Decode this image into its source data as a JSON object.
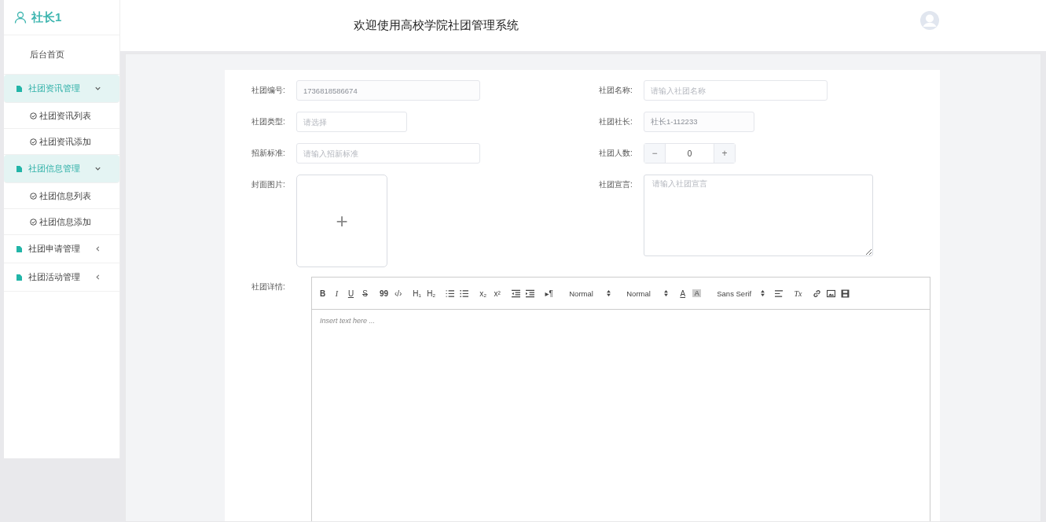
{
  "sidebar": {
    "user": "社长1",
    "items": [
      {
        "label": "后台首页",
        "kind": "link"
      },
      {
        "label": "社团资讯管理",
        "kind": "group",
        "expanded": true,
        "children": [
          {
            "label": "社团资讯列表"
          },
          {
            "label": "社团资讯添加"
          }
        ]
      },
      {
        "label": "社团信息管理",
        "kind": "group",
        "expanded": true,
        "children": [
          {
            "label": "社团信息列表"
          },
          {
            "label": "社团信息添加"
          }
        ]
      },
      {
        "label": "社团申请管理",
        "kind": "group",
        "expanded": false
      },
      {
        "label": "社团活动管理",
        "kind": "group",
        "expanded": false
      }
    ]
  },
  "header": {
    "title": "欢迎使用高校学院社团管理系统"
  },
  "form": {
    "left": [
      {
        "label": "社团编号:",
        "kind": "input",
        "value": "1736818586674",
        "disabled": true
      },
      {
        "label": "社团类型:",
        "kind": "select",
        "placeholder": "请选择"
      },
      {
        "label": "招新标准:",
        "kind": "input",
        "placeholder": "请输入招新标准"
      },
      {
        "label": "封面图片:",
        "kind": "upload",
        "button": "+"
      }
    ],
    "right": [
      {
        "label": "社团名称:",
        "kind": "input",
        "placeholder": "请输入社团名称"
      },
      {
        "label": "社团社长:",
        "kind": "input",
        "value": "社长1-112233",
        "disabled": true
      },
      {
        "label": "社团人数:",
        "kind": "number",
        "value": "0",
        "minus": "−",
        "plus": "+"
      },
      {
        "label": "社团宣言:",
        "kind": "textarea",
        "placeholder": "请输入社团宣言"
      }
    ],
    "editor": {
      "label": "社团详情:",
      "placeholder": "Insert text here ...",
      "toolbar": [
        [
          {
            "kind": "text",
            "label": "B"
          },
          {
            "kind": "text",
            "label": "I"
          },
          {
            "kind": "text",
            "label": "U"
          },
          {
            "kind": "text",
            "label": "S"
          }
        ],
        [
          {
            "kind": "text",
            "label": "99"
          },
          {
            "kind": "text",
            "label": "‹/›"
          }
        ],
        [
          {
            "kind": "text",
            "label": "H₁"
          },
          {
            "kind": "text",
            "label": "H₂"
          }
        ],
        [
          {
            "kind": "icon"
          },
          {
            "kind": "icon"
          }
        ],
        [
          {
            "kind": "text",
            "label": "x₂"
          },
          {
            "kind": "text",
            "label": "x²"
          }
        ],
        [
          {
            "kind": "icon"
          },
          {
            "kind": "icon"
          }
        ],
        [
          {
            "kind": "text",
            "label": "▸¶"
          }
        ],
        [
          {
            "kind": "picker",
            "label": "Normal"
          }
        ],
        [
          {
            "kind": "picker",
            "label": "Normal"
          }
        ],
        [
          {
            "kind": "text",
            "label": "A"
          },
          {
            "kind": "text",
            "label": "A"
          }
        ],
        [
          {
            "kind": "picker",
            "label": "Sans Serif"
          }
        ],
        [
          {
            "kind": "icon"
          }
        ],
        [
          {
            "kind": "text",
            "label": "Tx"
          }
        ],
        [
          {
            "kind": "icon"
          },
          {
            "kind": "icon"
          },
          {
            "kind": "icon"
          }
        ]
      ]
    }
  }
}
